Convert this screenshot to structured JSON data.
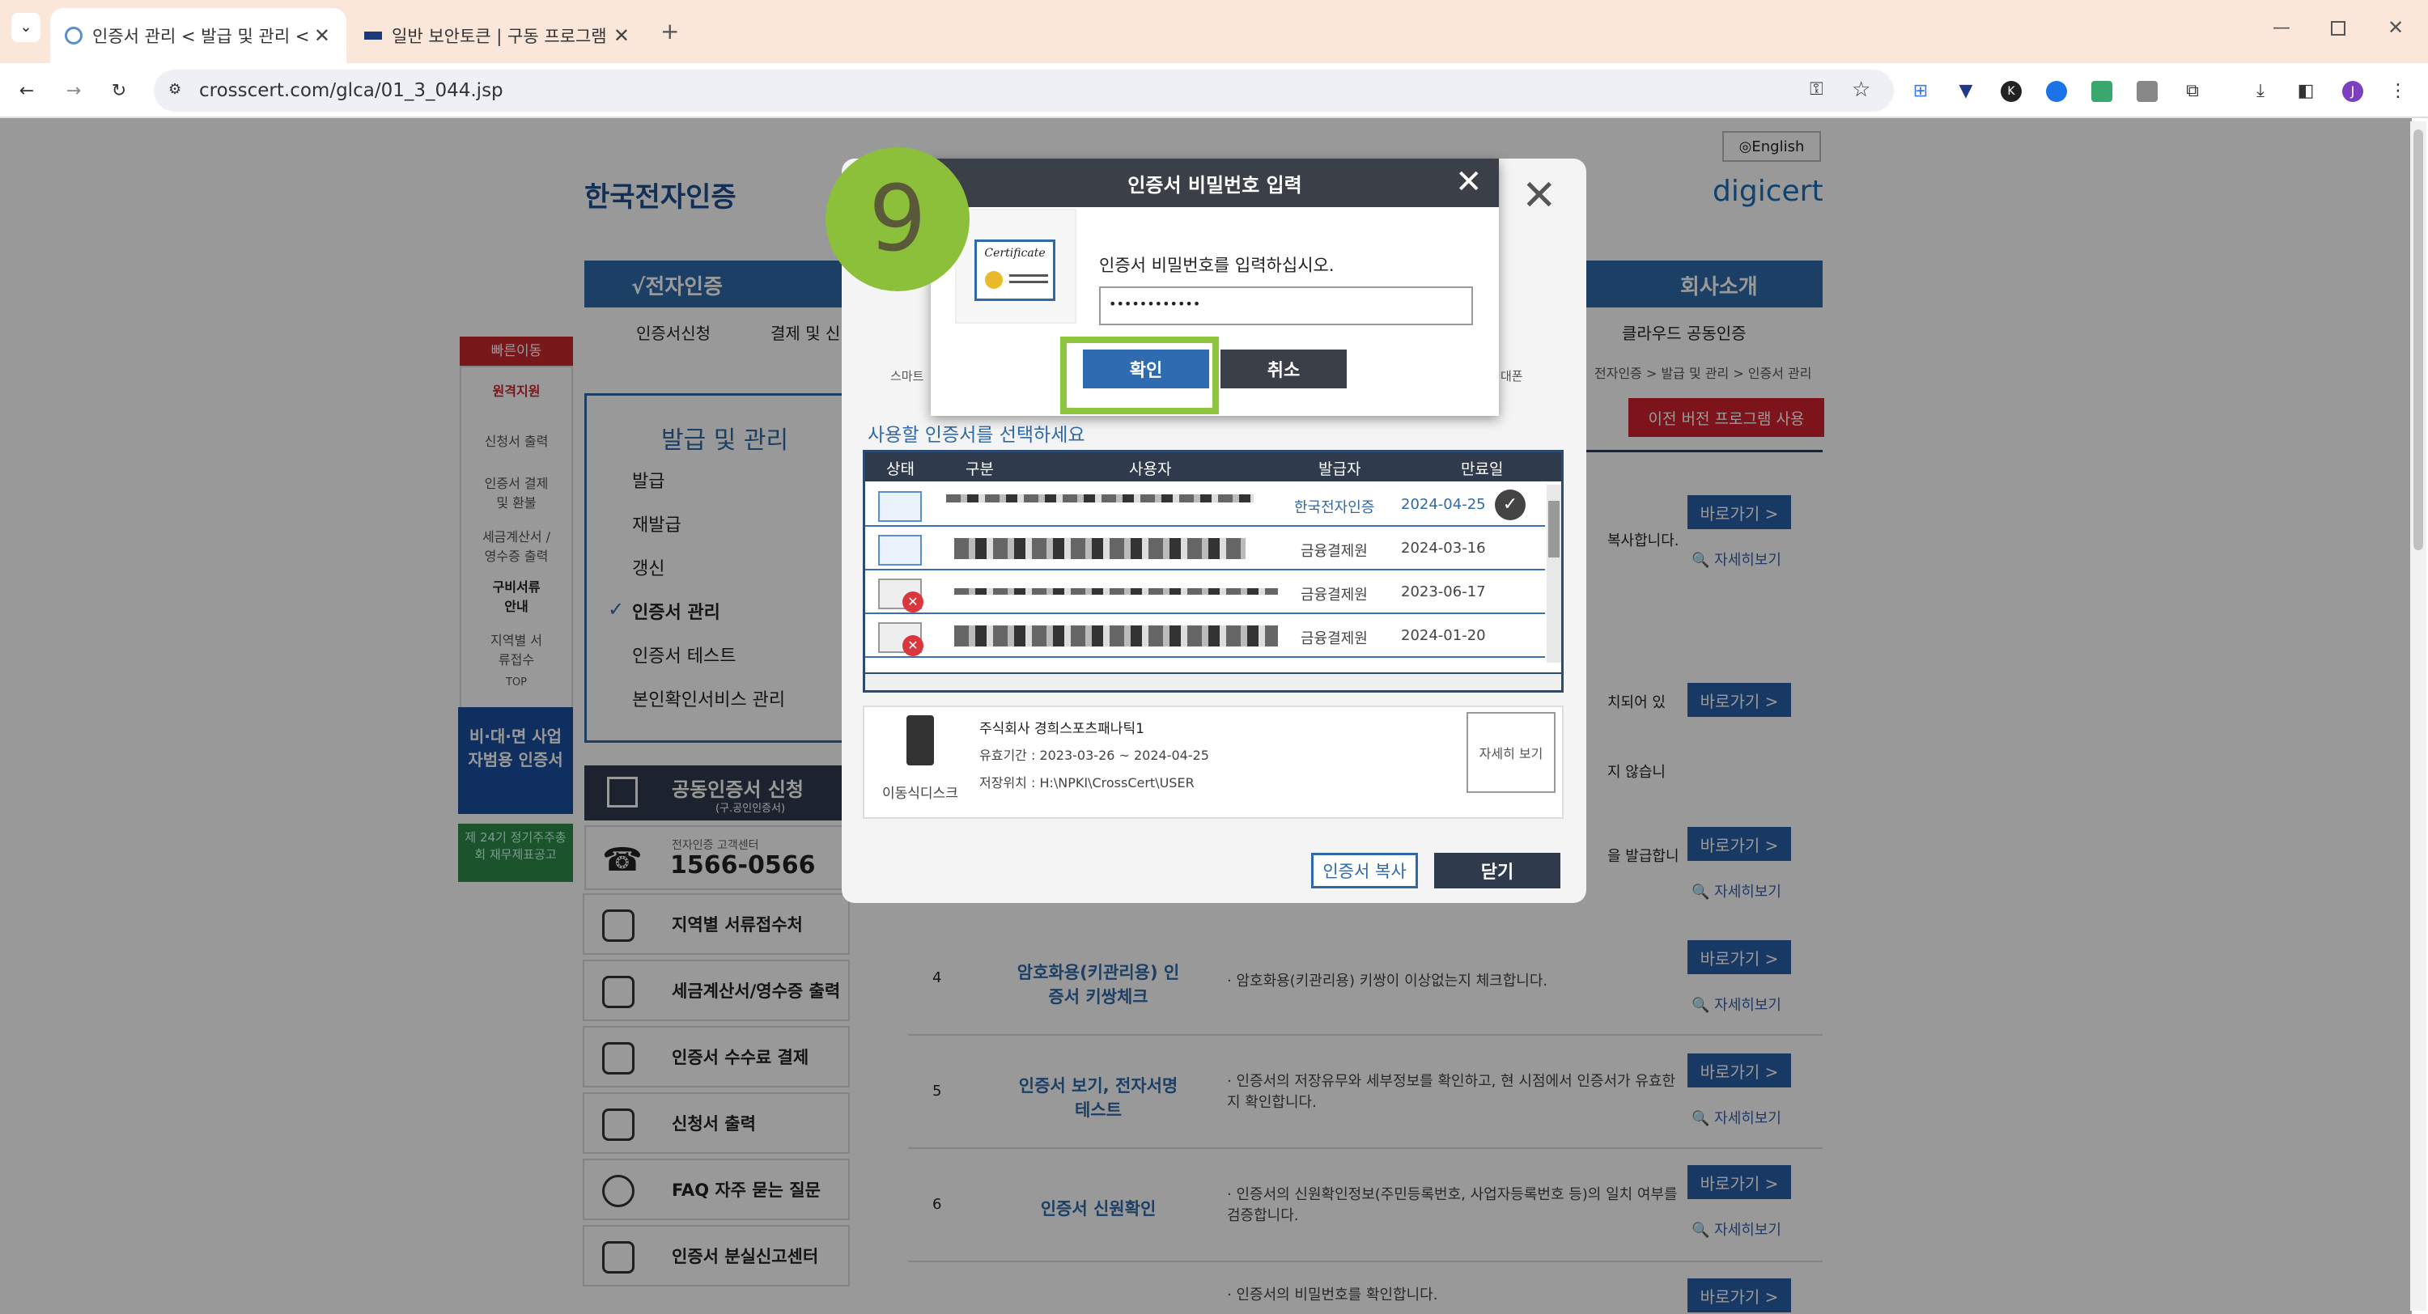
{
  "browser": {
    "tabs": [
      {
        "title": "인증서 관리 < 발급 및 관리 <",
        "active": true
      },
      {
        "title": "일반 보안토큰 | 구동 프로그램",
        "active": false
      }
    ],
    "url": "crosscert.com/glca/01_3_044.jsp",
    "profile_initial": "J"
  },
  "site": {
    "logo": "한국전자인증",
    "logo_en": "digicert",
    "lang_button": "English",
    "nav": {
      "main": "√전자인증",
      "company": "회사소개",
      "sub1": "인증서신청",
      "sub2": "결제 및 신",
      "cloud": "클라우드 공동인증"
    },
    "breadcrumb": "전자인증 > 발급 및 관리 > 인증서 관리",
    "old_version_button": "이전 버전 프로그램 사용",
    "quick": {
      "title": "빠른이동",
      "items": [
        "원격지원",
        "신청서 출력",
        "인증서 결제 및 환불",
        "세금계산서 /영수증 출력",
        "구비서류 안내",
        "지역별 서류접수",
        "TOP"
      ]
    },
    "menu": {
      "title": "발급 및 관리",
      "items": [
        "발급",
        "재발급",
        "갱신",
        "인증서 관리",
        "인증서 테스트",
        "본인확인서비스 관리"
      ]
    },
    "banner1": "비·대·면 사업자범용 인증서",
    "banner2": "제 24기 정기주주총회 재무제표공고",
    "apply": {
      "title": "공동인증서 신청",
      "sub": "(구.공인인증서)"
    },
    "phone": {
      "label": "전자인증 고객센터",
      "number": "1566-0566"
    },
    "side_buttons": [
      "지역별 서류접수처",
      "세금계산서/영수증 출력",
      "인증서 수수료 결제",
      "신청서 출력",
      "FAQ 자주 묻는 질문",
      "인증서 분실신고센터"
    ],
    "rows": [
      {
        "num": "4",
        "name": "암호화용(키관리용) 인증서 키쌍체크",
        "desc": "· 암호화용(키관리용) 키쌍이 이상없는지 체크합니다."
      },
      {
        "num": "5",
        "name": "인증서 보기, 전자서명 테스트",
        "desc": "· 인증서의 저장유무와 세부정보를 확인하고, 현 시점에서 인증서가 유효한지 확인합니다."
      },
      {
        "num": "6",
        "name": "인증서 신원확인",
        "desc": "· 인증서의 신원확인정보(주민등록번호, 사업자등록번호 등)의 일치 여부를 검증합니다."
      },
      {
        "num": "",
        "name": "",
        "desc": "· 인증서의 비밀번호를 확인합니다."
      }
    ],
    "row_go": "바로가기 >",
    "row_detail": "자세히보기",
    "right_snippets": [
      "복사합니다.",
      "치되어 있",
      "지 않습니",
      "을 발급합니"
    ]
  },
  "cert_dialog": {
    "select_title": "사용할 인증서를 선택하세요",
    "columns": [
      "상태",
      "구분",
      "사용자",
      "발급자",
      "만료일"
    ],
    "rows": [
      {
        "issuer": "한국전자인증",
        "expiry": "2024-04-25",
        "selected": true,
        "expired": false
      },
      {
        "issuer": "금융결제원",
        "expiry": "2024-03-16",
        "selected": false,
        "expired": false
      },
      {
        "issuer": "금융결제원",
        "expiry": "2023-06-17",
        "selected": false,
        "expired": true
      },
      {
        "issuer": "금융결제원",
        "expiry": "2024-01-20",
        "selected": false,
        "expired": true
      }
    ],
    "detail": {
      "company": "주식회사 경희스포츠패나틱1",
      "validity": "유효기간 : 2023-03-26 ~ 2024-04-25",
      "location": "저장위치 : H:\\NPKI\\CrossCert\\USER",
      "media": "이동식디스크",
      "view_button": "자세히 보기"
    },
    "copy_button": "인증서 복사",
    "close_button": "닫기",
    "top_left_label": "스마트",
    "top_right_label": "대폰"
  },
  "password_dialog": {
    "title": "인증서 비밀번호 입력",
    "prompt": "인증서 비밀번호를 입력하십시오.",
    "password_mask": "••••••••••••",
    "cert_label": "Certificate",
    "ok": "확인",
    "cancel": "취소"
  },
  "step_badge": "9",
  "colors": {
    "highlight": "#8cc63e",
    "badge": "#8cbf3a",
    "primary": "#2e6bb1"
  }
}
